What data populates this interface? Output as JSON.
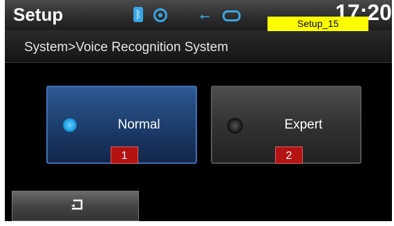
{
  "header": {
    "title": "Setup",
    "clock": "17:20",
    "tag": "Setup_15",
    "icons": [
      "bluetooth-icon",
      "disc-icon",
      "usb-icon",
      "ipod-icon"
    ],
    "accent": "#3aa6e6"
  },
  "breadcrumb": "System>Voice Recognition System",
  "options": [
    {
      "label": "Normal",
      "selected": true,
      "marker": "1"
    },
    {
      "label": "Expert",
      "selected": false,
      "marker": "2"
    }
  ],
  "back_icon": "back-arrow-icon"
}
